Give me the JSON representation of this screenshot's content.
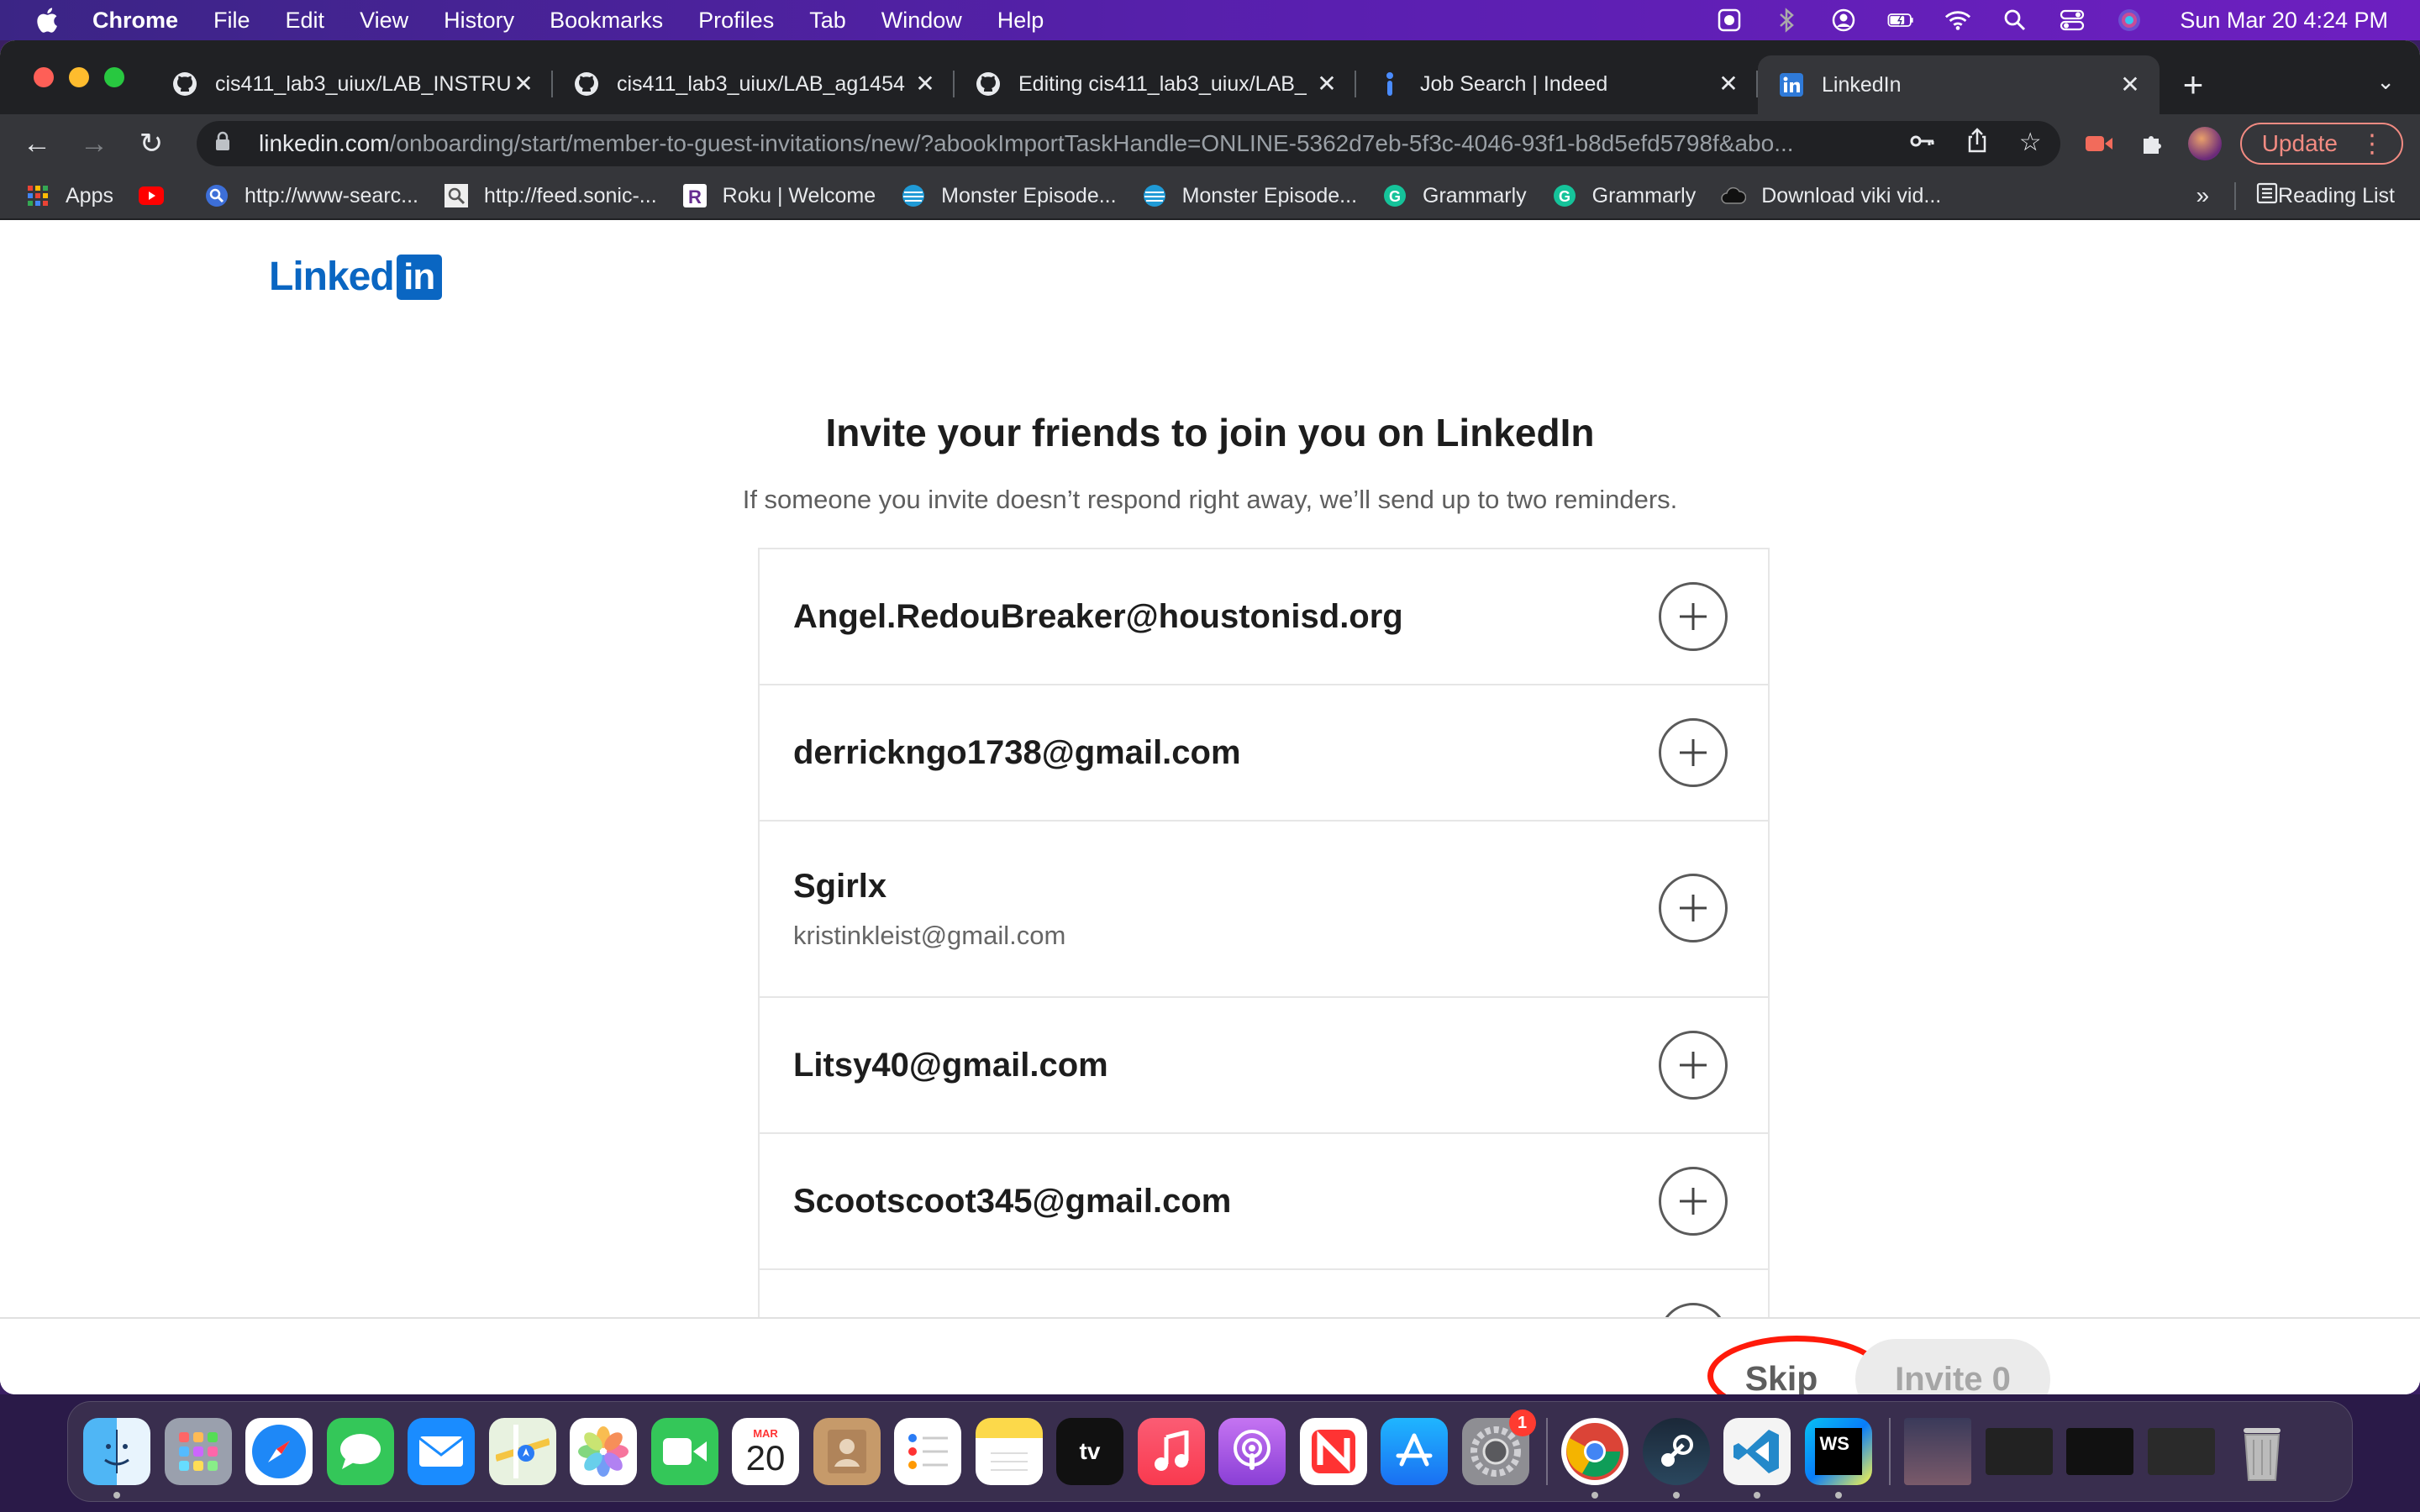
{
  "menubar": {
    "app_name": "Chrome",
    "items": [
      "File",
      "Edit",
      "View",
      "History",
      "Bookmarks",
      "Profiles",
      "Tab",
      "Window",
      "Help"
    ],
    "clock": "Sun Mar 20  4:24 PM"
  },
  "tabs": [
    {
      "title": "cis411_lab3_uiux/LAB_INSTRU",
      "icon": "github-icon"
    },
    {
      "title": "cis411_lab3_uiux/LAB_ag1454",
      "icon": "github-icon"
    },
    {
      "title": "Editing cis411_lab3_uiux/LAB_",
      "icon": "github-icon"
    },
    {
      "title": "Job Search | Indeed",
      "icon": "indeed-icon"
    },
    {
      "title": "LinkedIn",
      "icon": "linkedin-icon",
      "active": true
    }
  ],
  "omnibox": {
    "host": "linkedin.com",
    "path": "/onboarding/start/member-to-guest-invitations/new/?abookImportTaskHandle=ONLINE-5362d7eb-5f3c-4046-93f1-b8d5efd5798f&abo..."
  },
  "toolbar": {
    "update_label": "Update"
  },
  "bookmarks": {
    "items": [
      {
        "label": "Apps",
        "icon": "apps-grid-icon"
      },
      {
        "label": "",
        "icon": "youtube-icon"
      },
      {
        "label": "http://www-searc...",
        "icon": "search-globe-icon"
      },
      {
        "label": "http://feed.sonic-...",
        "icon": "magnifier-doc-icon"
      },
      {
        "label": "Roku | Welcome",
        "icon": "roku-icon"
      },
      {
        "label": "Monster Episode...",
        "icon": "att-icon"
      },
      {
        "label": "Monster Episode...",
        "icon": "att-icon"
      },
      {
        "label": "Grammarly",
        "icon": "grammarly-icon"
      },
      {
        "label": "Grammarly",
        "icon": "grammarly-icon"
      },
      {
        "label": "Download viki vid...",
        "icon": "cloud-icon"
      }
    ],
    "more": "»",
    "reading_list": "Reading List"
  },
  "page": {
    "logo_text": "Linked",
    "logo_in": "in",
    "heading": "Invite your friends to join you on LinkedIn",
    "subheading": "If someone you invite doesn’t respond right away, we’ll send up to two reminders.",
    "contacts": [
      {
        "name": "Angel.RedouBreaker@houstonisd.org",
        "email": ""
      },
      {
        "name": "derrickngo1738@gmail.com",
        "email": ""
      },
      {
        "name": "Sgirlx",
        "email": "kristinkleist@gmail.com"
      },
      {
        "name": "Litsy40@gmail.com",
        "email": ""
      },
      {
        "name": "Scootscoot345@gmail.com",
        "email": ""
      },
      {
        "name": "",
        "email": ""
      }
    ],
    "skip_label": "Skip",
    "invite_label": "Invite 0"
  },
  "dock": {
    "calendar_month": "MAR",
    "calendar_day": "20",
    "settings_badge": "1",
    "tv_label": "tv",
    "webstorm_label": "WS"
  },
  "colors": {
    "linkedin_blue": "#0a66c2",
    "annotation_red": "#ff1a0a",
    "chrome_dark": "#35363a"
  }
}
